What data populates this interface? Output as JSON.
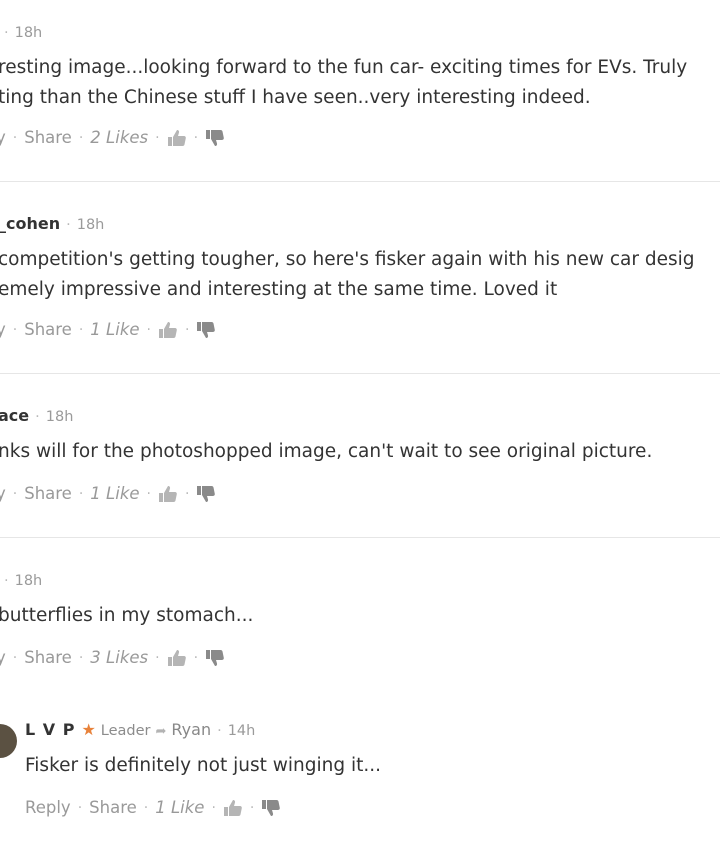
{
  "comments": [
    {
      "author": "",
      "time": "18h",
      "lines": [
        "resting image...looking forward to the fun car- exciting times for EVs. Truly",
        "ting than the Chinese stuff I have seen..very interesting indeed."
      ],
      "reply_fragment": "y",
      "share": "Share",
      "likes": "2 Likes"
    },
    {
      "author": "_cohen",
      "time": "18h",
      "lines": [
        "competition's getting tougher, so here's fisker again with his new car desig",
        "emely impressive and interesting at the same time. Loved it"
      ],
      "reply_fragment": "y",
      "share": "Share",
      "likes": "1 Like"
    },
    {
      "author": "ace",
      "time": "18h",
      "lines": [
        "nks will for the photoshopped image, can't wait to see original picture."
      ],
      "reply_fragment": "y",
      "share": "Share",
      "likes": "1 Like"
    },
    {
      "author": "",
      "time": "18h",
      "lines": [
        "butterflies in my stomach..."
      ],
      "reply_fragment": "y",
      "share": "Share",
      "likes": "3 Likes"
    }
  ],
  "nested_reply": {
    "author": "L V P",
    "badge": "Leader",
    "reply_to": "Ryan",
    "time": "14h",
    "text": "Fisker is definitely not just winging it...",
    "reply": "Reply",
    "share": "Share",
    "likes": "1 Like"
  },
  "colors": {
    "text": "#333333",
    "muted": "#999999",
    "star": "#e8823a",
    "separator": "#e6e6e6"
  }
}
